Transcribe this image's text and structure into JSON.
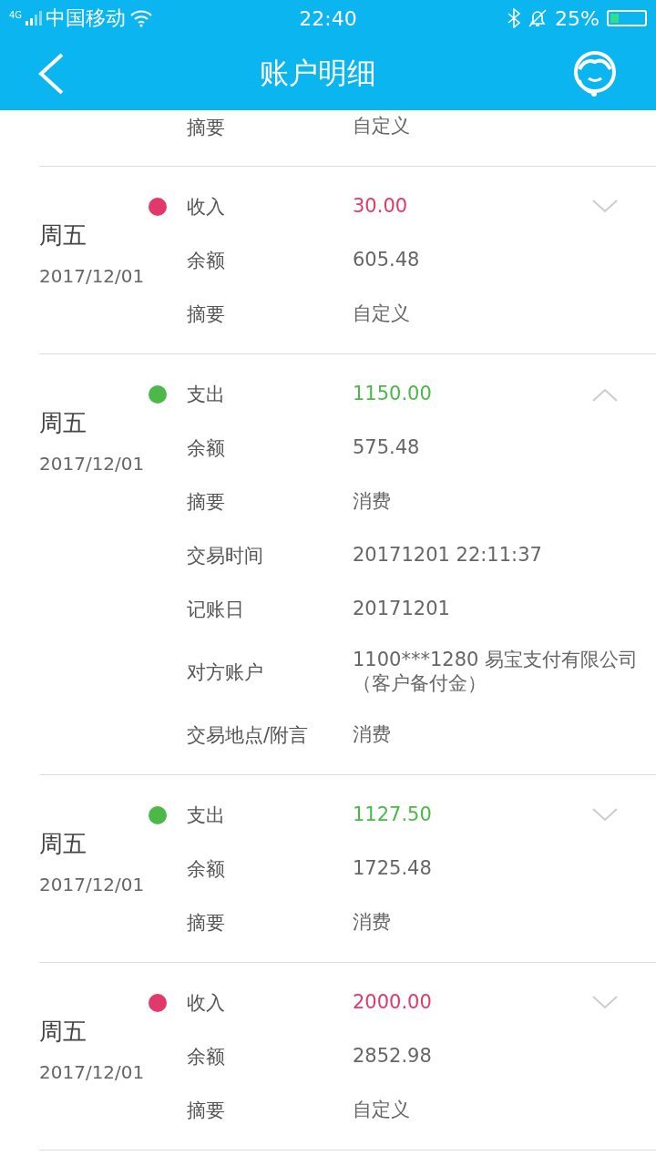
{
  "status_bar": {
    "network": "4G",
    "carrier": "中国移动",
    "time": "22:40",
    "battery": "25%"
  },
  "header": {
    "title": "账户明细"
  },
  "top_row": {
    "label": "摘要",
    "value": "自定义"
  },
  "records": [
    {
      "day": "周五",
      "date": "2017/12/01",
      "color": "#e0396a",
      "expanded": false,
      "rows": [
        {
          "label": "收入",
          "value": "30.00"
        },
        {
          "label": "余额",
          "value": "605.48"
        },
        {
          "label": "摘要",
          "value": "自定义"
        }
      ]
    },
    {
      "day": "周五",
      "date": "2017/12/01",
      "color": "#4cb848",
      "expanded": true,
      "rows": [
        {
          "label": "支出",
          "value": "1150.00"
        },
        {
          "label": "余额",
          "value": "575.48"
        },
        {
          "label": "摘要",
          "value": "消费"
        },
        {
          "label": "交易时间",
          "value": "20171201 22:11:37"
        },
        {
          "label": "记账日",
          "value": "20171201"
        },
        {
          "label": "对方账户",
          "value": "1100***1280 易宝支付有限公司（客户备付金）"
        },
        {
          "label": "交易地点/附言",
          "value": "消费"
        }
      ]
    },
    {
      "day": "周五",
      "date": "2017/12/01",
      "color": "#4cb848",
      "expanded": false,
      "rows": [
        {
          "label": "支出",
          "value": "1127.50"
        },
        {
          "label": "余额",
          "value": "1725.48"
        },
        {
          "label": "摘要",
          "value": "消费"
        }
      ]
    },
    {
      "day": "周五",
      "date": "2017/12/01",
      "color": "#e0396a",
      "expanded": false,
      "rows": [
        {
          "label": "收入",
          "value": "2000.00"
        },
        {
          "label": "余额",
          "value": "2852.98"
        },
        {
          "label": "摘要",
          "value": "自定义"
        }
      ]
    }
  ]
}
